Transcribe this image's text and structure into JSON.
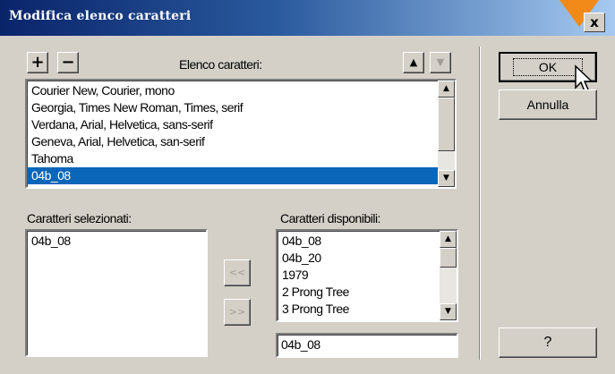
{
  "window": {
    "title": "Modifica elenco caratteri",
    "close_label": "x"
  },
  "toolbar": {
    "add_label": "+",
    "remove_label": "−",
    "move_up_label": "▲",
    "move_down_label": "▼"
  },
  "font_list": {
    "label": "Elenco caratteri:",
    "items": [
      "Courier New, Courier, mono",
      "Georgia, Times New Roman, Times, serif",
      "Verdana, Arial, Helvetica, sans-serif",
      "Geneva, Arial, Helvetica, san-serif",
      "Tahoma",
      "04b_08"
    ],
    "selected_index": 5
  },
  "selected_fonts": {
    "label": "Caratteri selezionati:",
    "items": [
      "04b_08"
    ]
  },
  "available_fonts": {
    "label": "Caratteri disponibili:",
    "items": [
      "04b_08",
      "04b_20",
      "1979",
      "2 Prong Tree",
      "3 Prong Tree"
    ],
    "input_value": "04b_08"
  },
  "transfer": {
    "add_label": "<<",
    "remove_label": ">>"
  },
  "buttons": {
    "ok_label": "OK",
    "cancel_label": "Annulla",
    "help_label": "?"
  },
  "colors": {
    "selection": "#0a66b8",
    "title_gradient_start": "#0a246a",
    "marker": "#f28a1a"
  }
}
